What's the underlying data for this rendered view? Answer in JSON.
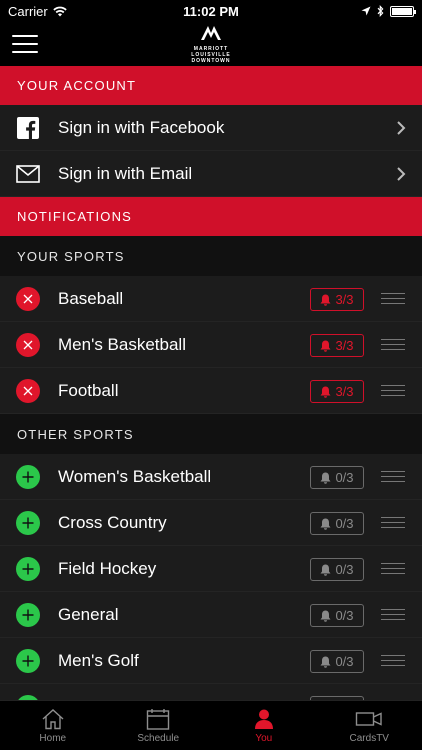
{
  "status_bar": {
    "carrier": "Carrier",
    "time": "11:02 PM"
  },
  "header": {
    "logo_lines": [
      "MARRIOTT",
      "LOUISVILLE",
      "DOWNTOWN"
    ]
  },
  "account": {
    "title": "YOUR ACCOUNT",
    "items": [
      {
        "label": "Sign in with Facebook",
        "icon": "facebook-icon"
      },
      {
        "label": "Sign in with Email",
        "icon": "envelope-icon"
      }
    ]
  },
  "notifications": {
    "title": "NOTIFICATIONS",
    "your_sports": {
      "title": "YOUR SPORTS",
      "items": [
        {
          "name": "Baseball",
          "count": "3/3"
        },
        {
          "name": "Men's Basketball",
          "count": "3/3"
        },
        {
          "name": "Football",
          "count": "3/3"
        }
      ]
    },
    "other_sports": {
      "title": "OTHER SPORTS",
      "items": [
        {
          "name": "Women's Basketball",
          "count": "0/3"
        },
        {
          "name": "Cross Country",
          "count": "0/3"
        },
        {
          "name": "Field Hockey",
          "count": "0/3"
        },
        {
          "name": "General",
          "count": "0/3"
        },
        {
          "name": "Men's Golf",
          "count": "0/3"
        }
      ]
    }
  },
  "tab_bar": {
    "tabs": [
      {
        "label": "Home",
        "icon": "home-icon"
      },
      {
        "label": "Schedule",
        "icon": "calendar-icon"
      },
      {
        "label": "You",
        "icon": "person-icon",
        "active": true
      },
      {
        "label": "CardsTV",
        "icon": "video-camera-icon"
      }
    ]
  },
  "colors": {
    "accent": "#d0102a",
    "add": "#2bc74a",
    "background": "#111111",
    "row": "#1c1c1c"
  }
}
